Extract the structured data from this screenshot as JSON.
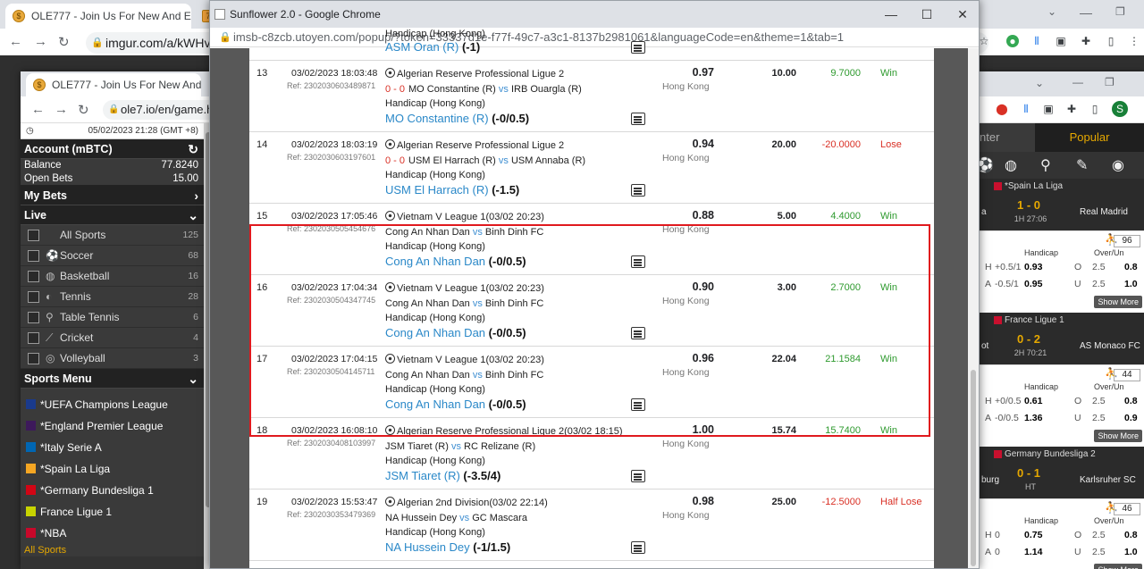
{
  "back_window": {
    "tabs": [
      {
        "title": "OLE777 - Join Us For New And E"
      },
      {
        "title": "7"
      }
    ],
    "url": "imgur.com/a/kWHvq"
  },
  "left_window": {
    "tab_title": "OLE777 - Join Us For New And E",
    "url": "ole7.io/en/game.h",
    "datetime": "05/02/2023 21:28 (GMT +8)",
    "account_title": "Account (mBTC)",
    "balance_label": "Balance",
    "balance_value": "77.8240",
    "open_bets_label": "Open Bets",
    "open_bets_value": "15.00",
    "my_bets": "My Bets",
    "live": "Live",
    "sports": [
      {
        "name": "All Sports",
        "count": "125",
        "icon": "grid-icon"
      },
      {
        "name": "Soccer",
        "count": "68",
        "icon": "soccer-ball-icon"
      },
      {
        "name": "Basketball",
        "count": "16",
        "icon": "basketball-icon"
      },
      {
        "name": "Tennis",
        "count": "28",
        "icon": "tennis-ball-icon"
      },
      {
        "name": "Table Tennis",
        "count": "6",
        "icon": "table-tennis-icon"
      },
      {
        "name": "Cricket",
        "count": "4",
        "icon": "cricket-icon"
      },
      {
        "name": "Volleyball",
        "count": "3",
        "icon": "volleyball-icon"
      }
    ],
    "sports_menu": "Sports Menu",
    "leagues": [
      {
        "name": "*UEFA Champions League",
        "color": "#1a3a8c"
      },
      {
        "name": "*England Premier League",
        "color": "#3d195b"
      },
      {
        "name": "*Italy Serie A",
        "color": "#0066b3"
      },
      {
        "name": "*Spain La Liga",
        "color": "#f5a623"
      },
      {
        "name": "*Germany Bundesliga 1",
        "color": "#d20515"
      },
      {
        "name": "France Ligue 1",
        "color": "#c8d400"
      },
      {
        "name": "*NBA",
        "color": "#c9082a"
      }
    ],
    "all_sports_cut": "All Sports"
  },
  "popup": {
    "title": "Sunflower 2.0 - Google Chrome",
    "url": "imsb-c8zcb.utoyen.com/popup/?token=33337d1e-f77f-49c7-a3c1-8137b2981061&languageCode=en&theme=1&tab=1",
    "top_partial": {
      "market": "Handicap (Hong Kong)",
      "team": "ASM Oran (R)",
      "hcap": "(-1)"
    },
    "bets": [
      {
        "no": "13",
        "datetime": "03/02/2023 18:03:48",
        "ref": "Ref: 2302030603489871",
        "league": "Algerian Reserve Professional Ligue 2",
        "score": "0 - 0",
        "home": "MO Constantine (R)",
        "away": "IRB Ouargla (R)",
        "market": "Handicap (Hong Kong)",
        "sel_team": "MO Constantine (R)",
        "sel_hcap": "(-0/0.5)",
        "odds": "0.97",
        "odds_type": "Hong Kong",
        "stake": "10.00",
        "winloss": "9.7000",
        "status": "Win",
        "positive": true
      },
      {
        "no": "14",
        "datetime": "03/02/2023 18:03:19",
        "ref": "Ref: 2302030603197601",
        "league": "Algerian Reserve Professional Ligue 2",
        "score": "0 - 0",
        "home": "USM El Harrach (R)",
        "away": "USM Annaba (R)",
        "market": "Handicap (Hong Kong)",
        "sel_team": "USM El Harrach (R)",
        "sel_hcap": "(-1.5)",
        "odds": "0.94",
        "odds_type": "Hong Kong",
        "stake": "20.00",
        "winloss": "-20.0000",
        "status": "Lose",
        "positive": false
      },
      {
        "no": "15",
        "datetime": "03/02/2023 17:05:46",
        "ref": "Ref: 2302030505454676",
        "league": "Vietnam V League 1(03/02 20:23)",
        "score": "",
        "home": "Cong An Nhan Dan",
        "away": "Binh Dinh FC",
        "market": "Handicap (Hong Kong)",
        "sel_team": "Cong An Nhan Dan",
        "sel_hcap": "(-0/0.5)",
        "odds": "0.88",
        "odds_type": "Hong Kong",
        "stake": "5.00",
        "winloss": "4.4000",
        "status": "Win",
        "positive": true
      },
      {
        "no": "16",
        "datetime": "03/02/2023 17:04:34",
        "ref": "Ref: 2302030504347745",
        "league": "Vietnam V League 1(03/02 20:23)",
        "score": "",
        "home": "Cong An Nhan Dan",
        "away": "Binh Dinh FC",
        "market": "Handicap (Hong Kong)",
        "sel_team": "Cong An Nhan Dan",
        "sel_hcap": "(-0/0.5)",
        "odds": "0.90",
        "odds_type": "Hong Kong",
        "stake": "3.00",
        "winloss": "2.7000",
        "status": "Win",
        "positive": true
      },
      {
        "no": "17",
        "datetime": "03/02/2023 17:04:15",
        "ref": "Ref: 2302030504145711",
        "league": "Vietnam V League 1(03/02 20:23)",
        "score": "",
        "home": "Cong An Nhan Dan",
        "away": "Binh Dinh FC",
        "market": "Handicap (Hong Kong)",
        "sel_team": "Cong An Nhan Dan",
        "sel_hcap": "(-0/0.5)",
        "odds": "0.96",
        "odds_type": "Hong Kong",
        "stake": "22.04",
        "winloss": "21.1584",
        "status": "Win",
        "positive": true
      },
      {
        "no": "18",
        "datetime": "03/02/2023 16:08:10",
        "ref": "Ref: 2302030408103997",
        "league": "Algerian Reserve Professional Ligue 2(03/02 18:15)",
        "score": "",
        "home": "JSM Tiaret (R)",
        "away": "RC Relizane (R)",
        "market": "Handicap (Hong Kong)",
        "sel_team": "JSM Tiaret (R)",
        "sel_hcap": "(-3.5/4)",
        "odds": "1.00",
        "odds_type": "Hong Kong",
        "stake": "15.74",
        "winloss": "15.7400",
        "status": "Win",
        "positive": true
      },
      {
        "no": "19",
        "datetime": "03/02/2023 15:53:47",
        "ref": "Ref: 2302030353479369",
        "league": "Algerian 2nd Division(03/02 22:14)",
        "score": "",
        "home": "NA Hussein Dey",
        "away": "GC Mascara",
        "market": "Handicap (Hong Kong)",
        "sel_team": "NA Hussein Dey",
        "sel_hcap": "(-1/1.5)",
        "odds": "0.98",
        "odds_type": "Hong Kong",
        "stake": "25.00",
        "winloss": "-12.5000",
        "status": "Half Lose",
        "positive": false
      }
    ],
    "vs": "vs"
  },
  "right_window": {
    "tab_center": "nter",
    "tab_popular": "Popular",
    "matches": [
      {
        "league": "*Spain La Liga",
        "home": "a",
        "away": "Real Madrid",
        "score": "1 - 0",
        "time": "1H 27:06",
        "more_count": "96",
        "rows": [
          {
            "s": "H",
            "h": "+0.5/1",
            "o": "0.93",
            "ou": "O",
            "l": "2.5",
            "v": "0.8"
          },
          {
            "s": "A",
            "h": "-0.5/1",
            "o": "0.95",
            "ou": "U",
            "l": "2.5",
            "v": "1.0"
          }
        ]
      },
      {
        "league": "France Ligue 1",
        "home": "ot",
        "away": "AS Monaco FC",
        "score": "0 - 2",
        "time": "2H 70:21",
        "more_count": "44",
        "rows": [
          {
            "s": "H",
            "h": "+0/0.5",
            "o": "0.61",
            "ou": "O",
            "l": "2.5",
            "v": "0.8"
          },
          {
            "s": "A",
            "h": "-0/0.5",
            "o": "1.36",
            "ou": "U",
            "l": "2.5",
            "v": "0.9"
          }
        ]
      },
      {
        "league": "Germany Bundesliga 2",
        "home": "burg",
        "away": "Karlsruher SC",
        "score": "0 - 1",
        "time": "HT",
        "more_count": "46",
        "rows": [
          {
            "s": "H",
            "h": "0",
            "o": "0.75",
            "ou": "O",
            "l": "2.5",
            "v": "0.8"
          },
          {
            "s": "A",
            "h": "0",
            "o": "1.14",
            "ou": "U",
            "l": "2.5",
            "v": "1.0"
          }
        ]
      }
    ],
    "handicap_label": "Handicap",
    "ou_label": "Over/Un",
    "show_more": "Show More"
  }
}
